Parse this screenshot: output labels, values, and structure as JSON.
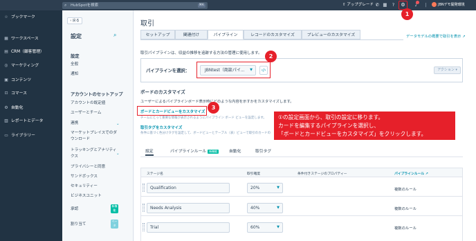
{
  "topbar": {
    "search_placeholder": "HubSpotを検索",
    "search_shortcut": "⌘K",
    "upgrade_label": "アップグレード",
    "account_name": "JBNデモ開発環境"
  },
  "leftnav": {
    "items": [
      {
        "label": "ブックマーク",
        "icon": "bookmark-icon",
        "glyph": "☆"
      },
      {
        "label": "ワークスペース",
        "icon": "workspace-icon",
        "glyph": "▦"
      },
      {
        "label": "CRM（顧客管理）",
        "icon": "crm-icon",
        "glyph": "▤"
      },
      {
        "label": "マーケティング",
        "icon": "marketing-icon",
        "glyph": "◎"
      },
      {
        "label": "コンテンツ",
        "icon": "content-icon",
        "glyph": "▣"
      },
      {
        "label": "コマース",
        "icon": "commerce-icon",
        "glyph": "⊡"
      },
      {
        "label": "自動化",
        "icon": "automation-icon",
        "glyph": "⚙"
      },
      {
        "label": "レポートとデータ",
        "icon": "reports-icon",
        "glyph": "▥"
      },
      {
        "label": "ライブラリー",
        "icon": "library-icon",
        "glyph": "▭"
      }
    ]
  },
  "settings_side": {
    "back_label": "戻る",
    "title": "設定",
    "section1_head": "設定",
    "link_general": "全般",
    "link_notifications": "通知",
    "section2_head": "アカウントのセットアップ",
    "link_defaults": "アカウントの既定値",
    "link_users": "ユーザーとチーム",
    "link_integrations": "連携",
    "link_marketplace_1": "マーケットプレイスでのダ",
    "link_marketplace_2": "ウンロード",
    "link_tracking_1": "トラッキングとアナリティ",
    "link_tracking_2": "クス",
    "link_privacy": "プライバシーと同意",
    "link_sandbox": "サンドボックス",
    "link_security": "セキュリティー",
    "link_business_units": "ビジネスユニット",
    "link_approvals": "承認",
    "link_assignments": "割り当て",
    "badge_new": "新機能",
    "badge_beta": "ベータ"
  },
  "main": {
    "page_title": "取引",
    "tabs": [
      "セットアップ",
      "関連付け",
      "パイプライン",
      "レコードのカスタマイズ",
      "プレビューのカスタマイズ"
    ],
    "data_model_link": "データモデルの概要で取引を表示",
    "description": "取引パイプラインは、収益の推移を追跡する方法の管理に使用します。",
    "pipeline_label": "パイプラインを選択：",
    "pipeline_value": "JBNtest（商談パイ...",
    "action_label": "アクション",
    "board_head": "ボードのカスタマイズ",
    "board_desc": "ユーザーによるパイプラインボード表示時にどのような内容を示すかをカスタマイズします。",
    "board_link": "ボードとカードビューをカスタマイズ",
    "board_sub": "チームにとって重要な情報が表示されるようにパイプライン ボード ビューを設定します。",
    "tag_link": "取引タグをカスタマイズ",
    "tag_sub": "条件に基づく色分けタグを設定して、ボードビューとテーブル（表）ビューで取引のカードの",
    "subtabs": [
      "設定",
      "パイプラインルール",
      "自動化",
      "取引タグ"
    ],
    "subtab_new": "新機能",
    "table_headers": [
      "ステージ名",
      "取引確度",
      "条件付きステージのプロパティー",
      "パイプラインルール"
    ],
    "rows": [
      {
        "stage": "Qualification",
        "prob": "20%",
        "rule": "複数のルール"
      },
      {
        "stage": "Needs Analysis",
        "prob": "40%",
        "rule": "複数のルール"
      },
      {
        "stage": "Trial",
        "prob": "60%",
        "rule": "複数のルール"
      }
    ]
  },
  "callout": {
    "line1": "①の設定画面から、取引の設定に移ります。",
    "line2": "カードを編集するパイプラインを選択し、",
    "line3": "「ボードとカードビューをカスタマイズ」をクリックします。"
  },
  "markers": [
    "1",
    "2",
    "3"
  ],
  "colors": {
    "accent_red": "#e6202a",
    "topbar": "#2d3e50",
    "nav": "#213343",
    "link": "#0091ae"
  }
}
